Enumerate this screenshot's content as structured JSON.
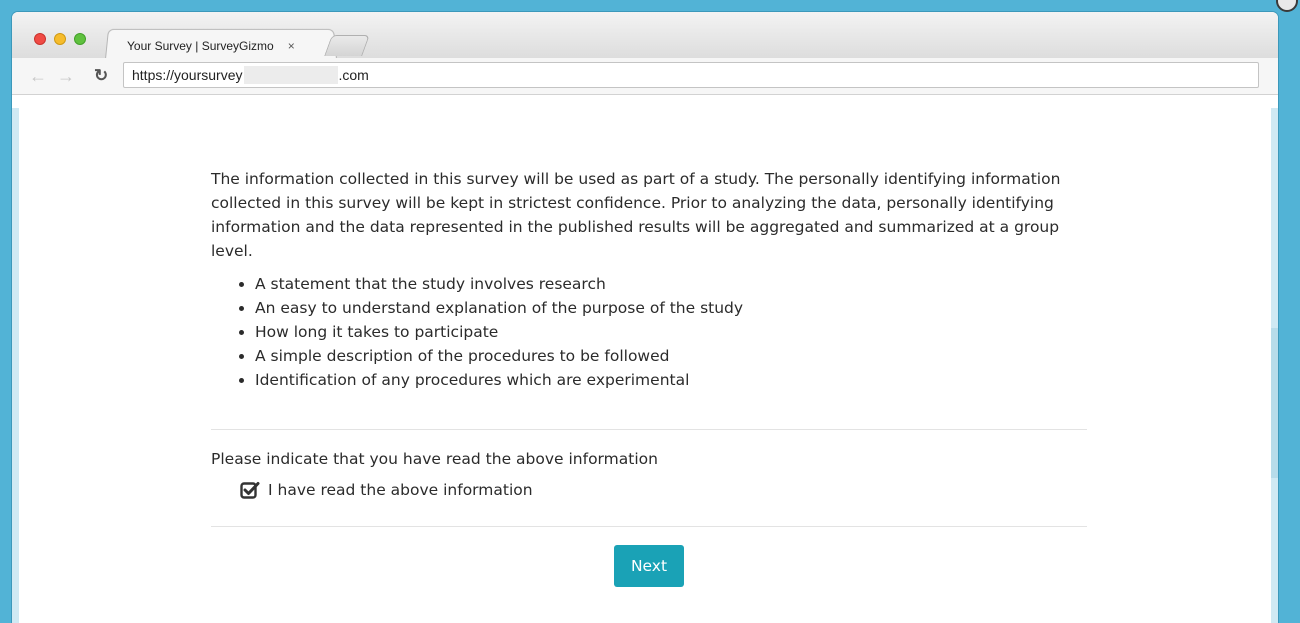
{
  "browser": {
    "tab_title": "Your Survey | SurveyGizmo",
    "tab_close": "×",
    "url_prefix": "https://yoursurvey",
    "url_suffix": ".com"
  },
  "icons": {
    "back": "back-arrow-icon",
    "forward": "forward-arrow-icon",
    "reload": "reload-icon",
    "checkbox": "checkbox-checked-icon"
  },
  "colors": {
    "accent": "#1aa2b6",
    "frame": "#52b3d6"
  },
  "survey": {
    "intro": "The information collected in this survey will be used as part of a study. The personally identifying information collected in this survey will be kept in strictest confidence. Prior to analyzing the data, personally identifying information and the data represented in the published results will be aggregated and summarized at a group level.",
    "bullets": [
      "A statement that the study involves research",
      "An easy to understand explanation of the purpose of the study",
      "How long it takes to participate",
      "A simple description of the procedures to be followed",
      "Identification of any procedures which are experimental"
    ],
    "question": "Please indicate that you have read the above information",
    "checkbox_label": "I have read the above information",
    "checkbox_checked": true,
    "next_label": "Next"
  }
}
